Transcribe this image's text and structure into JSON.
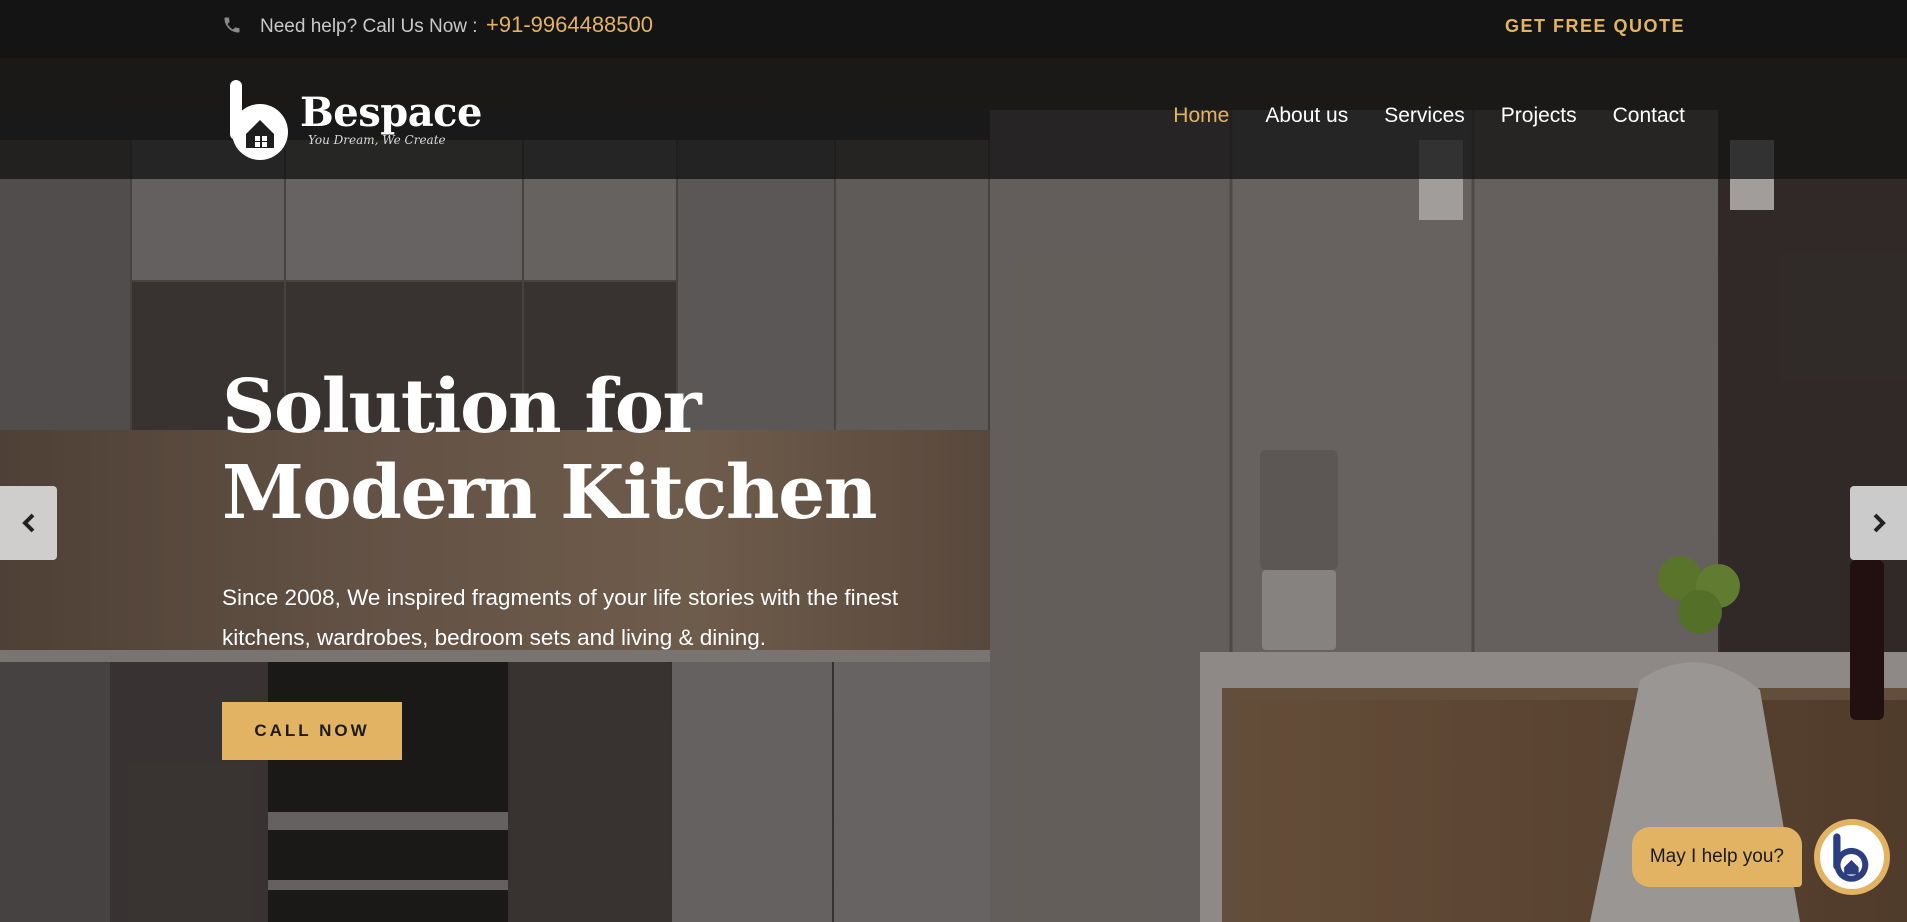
{
  "topbar": {
    "help_text": "Need help? Call Us Now :",
    "phone": "+91-9964488500",
    "quote_label": "GET FREE QUOTE"
  },
  "brand": {
    "name": "Bespace",
    "tagline": "You Dream, We Create"
  },
  "nav": {
    "items": [
      {
        "label": "Home",
        "active": true
      },
      {
        "label": "About us",
        "active": false
      },
      {
        "label": "Services",
        "active": false
      },
      {
        "label": "Projects",
        "active": false
      },
      {
        "label": "Contact",
        "active": false
      }
    ]
  },
  "hero": {
    "title_line1": "Solution for",
    "title_line2": "Modern Kitchen",
    "description": "Since 2008, We inspired fragments of your life stories with the finest kitchens, wardrobes, bedroom sets and living & dining.",
    "cta_label": "CALL NOW"
  },
  "chat": {
    "prompt": "May I help you?"
  },
  "icons": {
    "phone": "phone-icon",
    "prev": "chevron-left-icon",
    "next": "chevron-right-icon",
    "chat_avatar": "bespace-logo-icon"
  },
  "colors": {
    "accent": "#e3b364",
    "topbar_bg": "#141414",
    "header_bg": "#1e1e1e",
    "text_light": "#ffffff"
  }
}
